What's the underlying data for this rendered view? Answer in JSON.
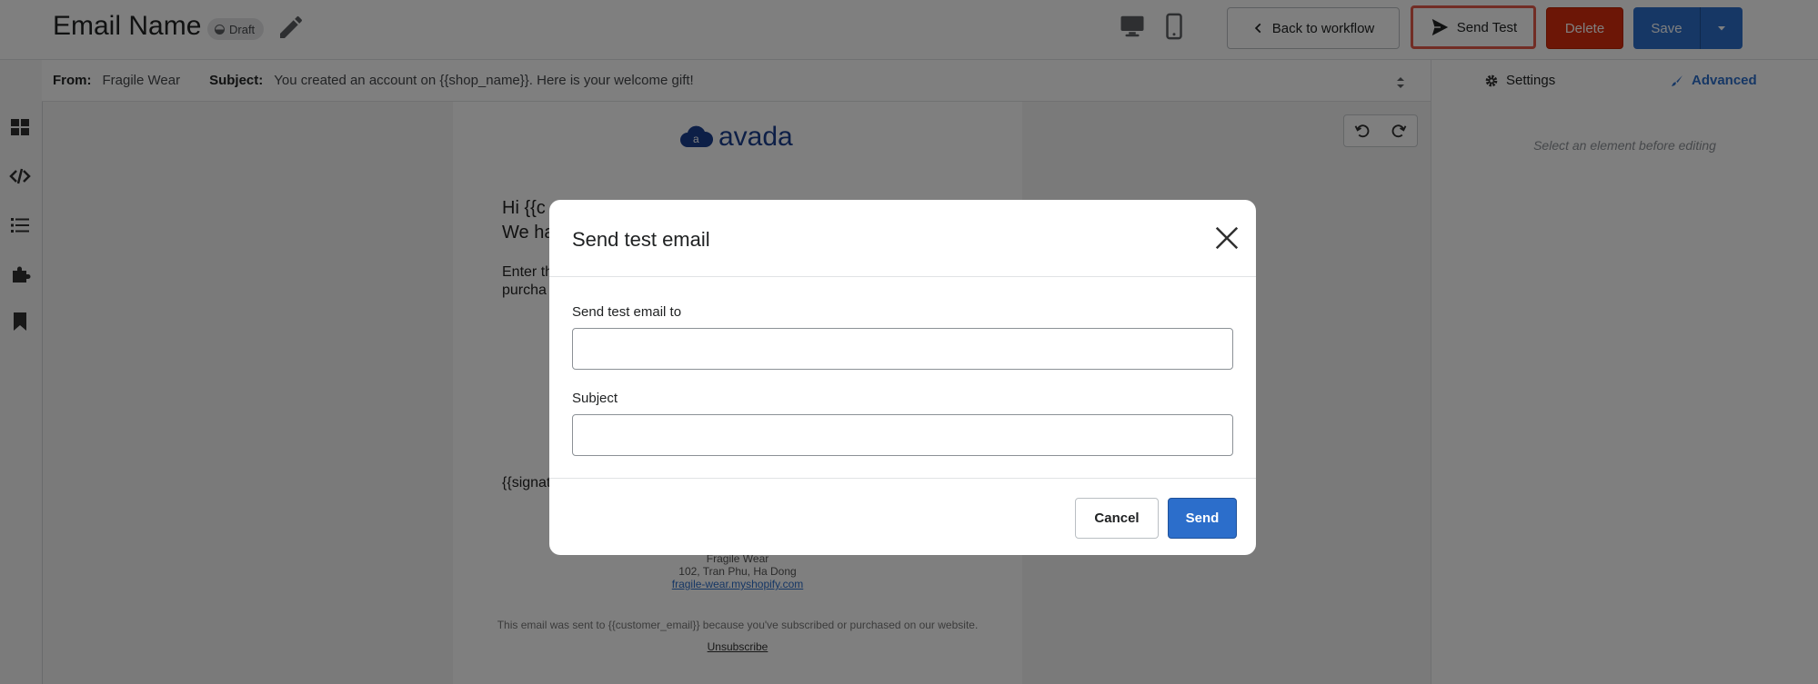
{
  "header": {
    "title": "Email Name",
    "status_badge": "Draft",
    "back_label": "Back to workflow",
    "send_test_label": "Send Test",
    "delete_label": "Delete",
    "save_label": "Save"
  },
  "infobar": {
    "from_label": "From:",
    "from_value": "Fragile Wear",
    "subject_label": "Subject:",
    "subject_value": "You created an account on {{shop_name}}. Here is your welcome gift!"
  },
  "right_panel": {
    "settings_label": "Settings",
    "advanced_label": "Advanced",
    "hint": "Select an element before editing"
  },
  "email": {
    "logo_text": "avada",
    "logo_letter": "a",
    "greeting_line1": "Hi {{c",
    "greeting_line2": "We ha",
    "body_line1": "Enter th",
    "body_line2": "purcha",
    "signature": "{{signat",
    "shop_name": "Fragile Wear",
    "address": "102, Tran Phu, Ha Dong",
    "shop_url": "fragile-wear.myshopify.com",
    "footer_note": "This email was sent to {{customer_email}} because you've subscribed or purchased on our website.",
    "unsubscribe": "Unsubscribe"
  },
  "modal": {
    "title": "Send test email",
    "email_label": "Send test email to",
    "email_value": "",
    "subject_label": "Subject",
    "subject_value": "",
    "cancel_label": "Cancel",
    "send_label": "Send"
  },
  "colors": {
    "primary": "#2c6ecb",
    "critical": "#d82c0d",
    "highlight": "#e45b4a",
    "brand_logo": "#1a3e8f"
  }
}
